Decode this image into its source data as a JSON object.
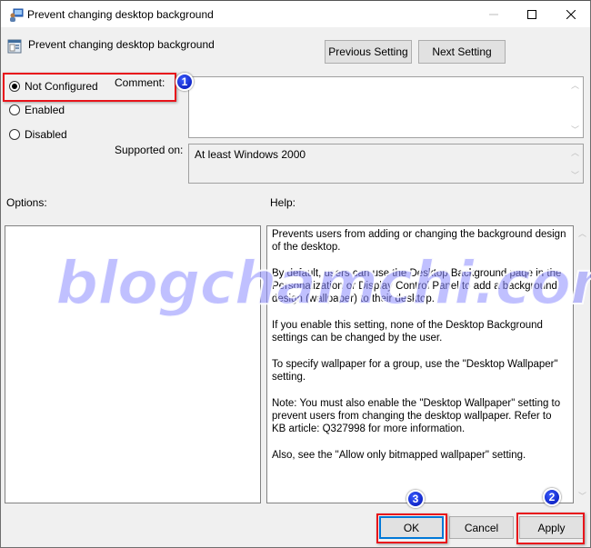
{
  "window": {
    "title": "Prevent changing desktop background",
    "controls": {
      "minimize": "—",
      "maximize": "☐",
      "close": "✕"
    }
  },
  "header": {
    "policy_name": "Prevent changing desktop background",
    "previous_setting_label": "Previous Setting",
    "next_setting_label": "Next Setting"
  },
  "state": {
    "options": [
      {
        "label": "Not Configured",
        "selected": true
      },
      {
        "label": "Enabled",
        "selected": false
      },
      {
        "label": "Disabled",
        "selected": false
      }
    ]
  },
  "comment": {
    "label": "Comment:",
    "value": ""
  },
  "supported": {
    "label": "Supported on:",
    "value": "At least Windows 2000"
  },
  "options_label": "Options:",
  "help": {
    "label": "Help:",
    "paragraphs": [
      "Prevents users from adding or changing the background design of the desktop.",
      "By default, users can use the Desktop Background page in the Personalization or Display Control Panel to add a background design (wallpaper) to their desktop.",
      "If you enable this setting, none of the Desktop Background settings can be changed by the user.",
      "To specify wallpaper for a group, use the \"Desktop Wallpaper\" setting.",
      "Note: You must also enable the \"Desktop Wallpaper\" setting to prevent users from changing the desktop wallpaper. Refer to KB article: Q327998 for more information.",
      "Also, see the \"Allow only bitmapped wallpaper\" setting."
    ]
  },
  "footer": {
    "ok_label": "OK",
    "cancel_label": "Cancel",
    "apply_label": "Apply"
  },
  "annotations": {
    "badge_1": "1",
    "badge_2": "2",
    "badge_3": "3",
    "highlight_color": "#e8141b",
    "badge_color": "#0a1fd0"
  },
  "watermark": "blogchamchi.com"
}
